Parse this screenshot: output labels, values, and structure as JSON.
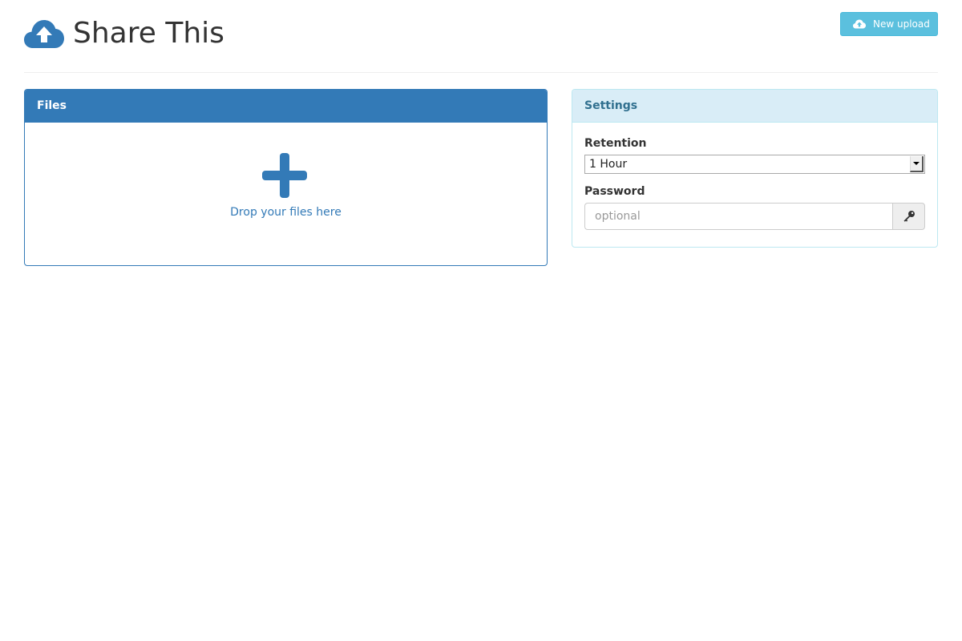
{
  "header": {
    "title": "Share This",
    "logo_icon": "cloud-upload-icon",
    "new_upload_label": "New upload",
    "new_upload_icon": "cloud-upload-icon"
  },
  "files_panel": {
    "heading": "Files",
    "dropzone_icon": "plus-icon",
    "dropzone_label": "Drop your files here"
  },
  "settings_panel": {
    "heading": "Settings",
    "retention": {
      "label": "Retention",
      "selected": "1 Hour"
    },
    "password": {
      "label": "Password",
      "placeholder": "optional",
      "value": "",
      "button_icon": "key-icon"
    }
  },
  "colors": {
    "primary": "#337ab7",
    "info": "#5bc0de",
    "info_bg": "#d9edf7",
    "info_text": "#31708f"
  }
}
